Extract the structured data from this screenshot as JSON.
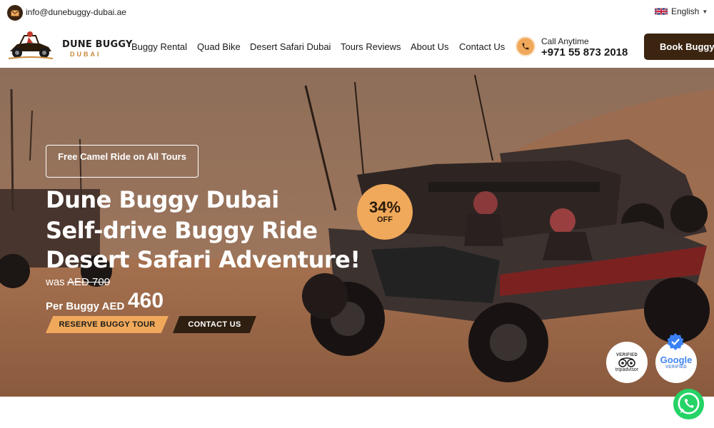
{
  "topbar": {
    "email": "info@dunebuggy-dubai.ae",
    "language": "English"
  },
  "logo": {
    "line1": "DUNE BUGGY",
    "line2": "DUBAI"
  },
  "nav": {
    "items": [
      {
        "label": "Buggy Rental"
      },
      {
        "label": "Quad Bike"
      },
      {
        "label": "Desert Safari Dubai"
      },
      {
        "label": "Tours Reviews"
      },
      {
        "label": "About Us"
      },
      {
        "label": "Contact Us"
      }
    ],
    "call_label": "Call Anytime",
    "call_number": "+971 55 873 2018",
    "book_label": "Book Buggy"
  },
  "hero": {
    "promo": "Free Camel Ride on All Tours",
    "headline": [
      "Dune Buggy Dubai",
      "Self-drive Buggy Ride",
      "Desert Safari Adventure!"
    ],
    "was_prefix": "was",
    "was_price": "AED 700",
    "price_prefix": "Per Buggy AED",
    "price": "460",
    "reserve_label": "RESERVE BUGGY TOUR",
    "contact_label": "CONTACT US",
    "discount_pct": "34%",
    "discount_label": "OFF"
  },
  "badges": {
    "tripadvisor_verified": "VERIFIED",
    "tripadvisor_name": "tripadvisor",
    "google_name": "Google",
    "google_verified": "VERIFIED"
  },
  "colors": {
    "accent": "#f0a95b",
    "brand_dark": "#3b2410",
    "whatsapp": "#25d366"
  },
  "icons": [
    "mail-icon",
    "uk-flag-icon",
    "phone-icon",
    "whatsapp-icon",
    "verified-check-icon",
    "tripadvisor-owl-icon"
  ]
}
